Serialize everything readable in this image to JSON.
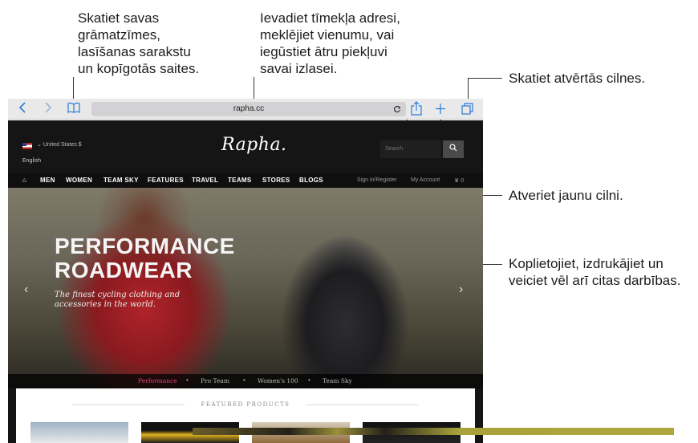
{
  "callouts": {
    "bookmarks": [
      "Skatiet savas",
      "grāmatzīmes,",
      "lasīšanas sarakstu",
      "un kopīgotās saites."
    ],
    "address": [
      "Ievadiet tīmekļa adresi,",
      "meklējiet vienumu, vai",
      "iegūstiet ātru piekļuvi",
      "savai izlasei."
    ],
    "tabs": "Skatiet atvērtās cilnes.",
    "new_tab": "Atveriet jaunu cilni.",
    "share": [
      "Koplietojiet, izdrukājiet un",
      "veiciet vēl arī citas darbības."
    ]
  },
  "toolbar": {
    "back_icon": "chevron-left-icon",
    "forward_icon": "chevron-right-icon",
    "bookmarks_icon": "book-icon",
    "url": "rapha.cc",
    "reload_icon": "reload-icon",
    "share_icon": "share-icon",
    "new_tab_icon": "plus-icon",
    "tabs_icon": "tabs-icon"
  },
  "site": {
    "region": "United States $",
    "language": "English",
    "logo": "Rapha.",
    "search_placeholder": "Search",
    "nav": [
      "MEN",
      "WOMEN",
      "TEAM SKY",
      "FEATURES",
      "TRAVEL",
      "TEAMS",
      "STORES",
      "BLOGS"
    ],
    "nav_right": {
      "signin": "Sign in/Register",
      "account": "My Account",
      "basket_count": "0"
    },
    "hero": {
      "title": [
        "PERFORMANCE",
        "ROADWEAR"
      ],
      "subtitle": [
        "The finest cycling clothing and",
        "accessories in the world."
      ]
    },
    "subnav": [
      "Performance",
      "Pro Team",
      "Women's 100",
      "Team Sky"
    ],
    "featured_heading": "FEATURED PRODUCTS"
  },
  "colors": {
    "accent": "#2a7ad6",
    "subnav_active": "#e0457b"
  }
}
